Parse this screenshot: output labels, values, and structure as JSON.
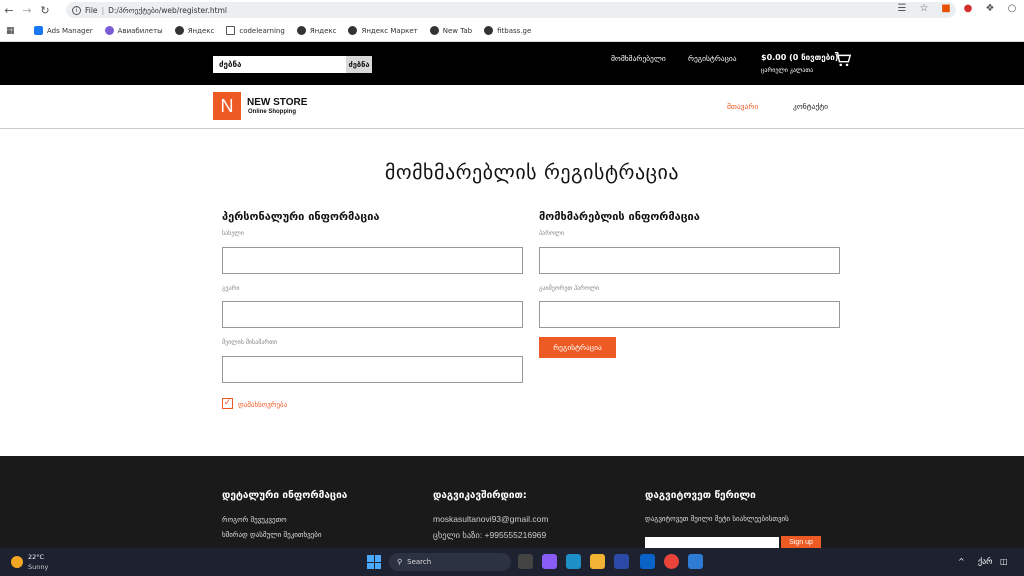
{
  "browser": {
    "file_label": "File",
    "url": "D:/პროექტები/web/register.html",
    "bookmarks": [
      "Ads Manager",
      "Авиабилеты",
      "Яндекс",
      "codelearning",
      "Яндекс",
      "Яндекс Маркет",
      "New Tab",
      "fitbass.ge"
    ]
  },
  "topbar": {
    "search_value": "ძებნა",
    "search_button": "ძებნა",
    "user_link": "მომხმარებელი",
    "register_link": "რეგისტრაცია",
    "cart_total": "$0.00 (0 ნივთები)",
    "cart_status": "ცარიელი კალათა"
  },
  "header": {
    "logo_letter": "N",
    "logo_name": "NEW STORE",
    "logo_sub": "Online Shopping",
    "nav": [
      "მთავარი",
      "კონტაქტი"
    ]
  },
  "main": {
    "title": "მომხმარებლის რეგისტრაცია",
    "personal_title": "პერსონალური ინფორმაცია",
    "user_title": "მომხმარებლის ინფორმაცია",
    "name_label": "სახელი",
    "surname_label": "გვარი",
    "email_label": "მეილის მისამართი",
    "password_label": "პაროლი",
    "confirm_label": "გაიმეორეთ პაროლი",
    "remember_label": "დამახსოვრება",
    "register_button": "რეგისტრაცია"
  },
  "footer": {
    "details_title": "დეტალური ინფორმაცია",
    "details_links": [
      "როგორ შევუკვეთო",
      "ხშირად დასმული შეკითხვები"
    ],
    "contact_title": "დაგვიკავშირდით:",
    "contact_email": "moskasultanovi93@gmail.com",
    "contact_phone": "ცხელი ხაზი: +995555216969",
    "newsletter_title": "დაგვიტოვეთ წერილი",
    "newsletter_text": "დაგვიტოვეთ მეილი მეტი სიახლეებისთვის",
    "signup_button": "Sign up"
  },
  "taskbar": {
    "temp": "22°C",
    "weather": "Sunny",
    "search_placeholder": "Search",
    "lang": "ქარ"
  }
}
